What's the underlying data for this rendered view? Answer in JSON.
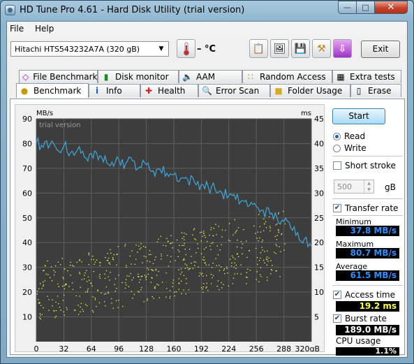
{
  "window": {
    "title": "HD Tune Pro 4.61 - Hard Disk Utility (trial version)"
  },
  "menu": {
    "items": [
      "File",
      "Help"
    ]
  },
  "toolbar": {
    "drive": "Hitachi HTS543232A7A     (320 gB)",
    "temperature": "– °C",
    "exit_label": "Exit"
  },
  "tabs_row1": [
    "File Benchmark",
    "Disk monitor",
    "AAM",
    "Random Access",
    "Extra tests"
  ],
  "tabs_row2": [
    "Benchmark",
    "Info",
    "Health",
    "Error Scan",
    "Folder Usage",
    "Erase"
  ],
  "side": {
    "start_label": "Start",
    "read_label": "Read",
    "write_label": "Write",
    "short_stroke_label": "Short stroke",
    "stroke_value": "500",
    "stroke_unit": "gB",
    "transfer_rate_label": "Transfer rate",
    "minimum_label": "Minimum",
    "minimum_value": "37.8 MB/s",
    "maximum_label": "Maximum",
    "maximum_value": "80.7 MB/s",
    "average_label": "Average",
    "average_value": "61.5 MB/s",
    "access_time_label": "Access time",
    "access_time_value": "19.2 ms",
    "burst_rate_label": "Burst rate",
    "burst_rate_value": "189.0 MB/s",
    "cpu_usage_label": "CPU usage",
    "cpu_usage_value": "1.1%"
  },
  "chart_data": {
    "type": "line",
    "watermark": "trial version",
    "left_axis_unit": "MB/s",
    "right_axis_unit": "ms",
    "y_left_ticks": [
      10,
      20,
      30,
      40,
      50,
      60,
      70,
      80,
      90
    ],
    "y_right_ticks": [
      5,
      10,
      15,
      20,
      25,
      30,
      35,
      40,
      45
    ],
    "x_ticks": [
      "0",
      "32",
      "64",
      "96",
      "128",
      "160",
      "192",
      "224",
      "256",
      "288",
      "320gB"
    ],
    "ylim_left": [
      0,
      90
    ],
    "ylim_right": [
      0,
      45
    ],
    "xlim": [
      0,
      320
    ],
    "grid": true,
    "series": [
      {
        "name": "Transfer rate",
        "axis": "left",
        "color": "#3ea8dc",
        "x": [
          0,
          8,
          16,
          24,
          32,
          40,
          48,
          56,
          64,
          72,
          80,
          88,
          96,
          104,
          112,
          120,
          128,
          136,
          144,
          152,
          160,
          168,
          176,
          184,
          192,
          200,
          208,
          216,
          224,
          232,
          240,
          248,
          256,
          264,
          272,
          280,
          288,
          296,
          304,
          312,
          320
        ],
        "values": [
          80.5,
          78.5,
          79.5,
          77.5,
          79,
          76.5,
          77.5,
          74.5,
          76,
          73.5,
          75,
          72.5,
          73.5,
          72,
          73,
          70.5,
          71.5,
          69,
          69.5,
          68,
          67.5,
          66,
          65.5,
          64.5,
          63.5,
          62.5,
          61.5,
          60,
          59,
          57.5,
          57,
          55,
          54.5,
          53,
          51.5,
          50,
          48.5,
          46,
          44,
          41.5,
          38.5
        ]
      },
      {
        "name": "Access time",
        "axis": "right",
        "type": "scatter",
        "color": "#ffff40",
        "x_range": [
          0,
          290
        ],
        "min_ms_range": [
          4,
          13
        ],
        "max_ms_range": [
          16,
          27
        ]
      }
    ]
  },
  "colors": {
    "plot_background": "#3d3d3d",
    "grid": "#5e5e5e",
    "transfer_line": "#3ea8dc",
    "access_points": "#ffff40",
    "accent": "#1d5ea8"
  }
}
